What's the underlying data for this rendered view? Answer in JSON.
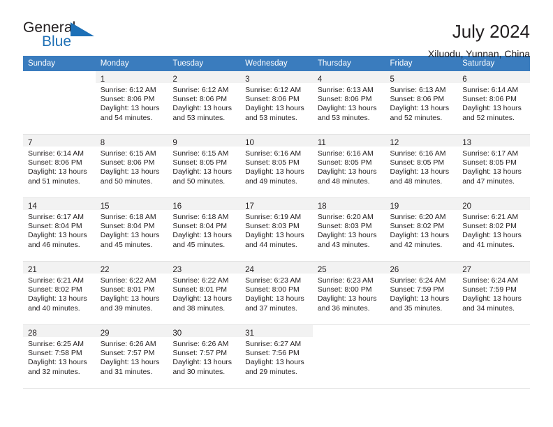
{
  "brand": {
    "name_part1": "General",
    "name_part2": "Blue",
    "triangle_color": "#1d70b7",
    "blue_text_color": "#2071b5"
  },
  "header": {
    "title": "July 2024",
    "subtitle": "Xiluodu, Yunnan, China"
  },
  "theme": {
    "header_row_bg": "#3a7cbe",
    "header_row_text": "#ffffff",
    "daynum_band_bg": "#f2f2f2",
    "grid_line": "#e2e2e2",
    "body_text": "#231f20"
  },
  "weekday_headers": [
    "Sunday",
    "Monday",
    "Tuesday",
    "Wednesday",
    "Thursday",
    "Friday",
    "Saturday"
  ],
  "weeks": [
    [
      {
        "day": "",
        "sunrise": "",
        "sunset": "",
        "daylight_line1": "",
        "daylight_line2": ""
      },
      {
        "day": "1",
        "sunrise": "Sunrise: 6:12 AM",
        "sunset": "Sunset: 8:06 PM",
        "daylight_line1": "Daylight: 13 hours",
        "daylight_line2": "and 54 minutes."
      },
      {
        "day": "2",
        "sunrise": "Sunrise: 6:12 AM",
        "sunset": "Sunset: 8:06 PM",
        "daylight_line1": "Daylight: 13 hours",
        "daylight_line2": "and 53 minutes."
      },
      {
        "day": "3",
        "sunrise": "Sunrise: 6:12 AM",
        "sunset": "Sunset: 8:06 PM",
        "daylight_line1": "Daylight: 13 hours",
        "daylight_line2": "and 53 minutes."
      },
      {
        "day": "4",
        "sunrise": "Sunrise: 6:13 AM",
        "sunset": "Sunset: 8:06 PM",
        "daylight_line1": "Daylight: 13 hours",
        "daylight_line2": "and 53 minutes."
      },
      {
        "day": "5",
        "sunrise": "Sunrise: 6:13 AM",
        "sunset": "Sunset: 8:06 PM",
        "daylight_line1": "Daylight: 13 hours",
        "daylight_line2": "and 52 minutes."
      },
      {
        "day": "6",
        "sunrise": "Sunrise: 6:14 AM",
        "sunset": "Sunset: 8:06 PM",
        "daylight_line1": "Daylight: 13 hours",
        "daylight_line2": "and 52 minutes."
      }
    ],
    [
      {
        "day": "7",
        "sunrise": "Sunrise: 6:14 AM",
        "sunset": "Sunset: 8:06 PM",
        "daylight_line1": "Daylight: 13 hours",
        "daylight_line2": "and 51 minutes."
      },
      {
        "day": "8",
        "sunrise": "Sunrise: 6:15 AM",
        "sunset": "Sunset: 8:06 PM",
        "daylight_line1": "Daylight: 13 hours",
        "daylight_line2": "and 50 minutes."
      },
      {
        "day": "9",
        "sunrise": "Sunrise: 6:15 AM",
        "sunset": "Sunset: 8:05 PM",
        "daylight_line1": "Daylight: 13 hours",
        "daylight_line2": "and 50 minutes."
      },
      {
        "day": "10",
        "sunrise": "Sunrise: 6:16 AM",
        "sunset": "Sunset: 8:05 PM",
        "daylight_line1": "Daylight: 13 hours",
        "daylight_line2": "and 49 minutes."
      },
      {
        "day": "11",
        "sunrise": "Sunrise: 6:16 AM",
        "sunset": "Sunset: 8:05 PM",
        "daylight_line1": "Daylight: 13 hours",
        "daylight_line2": "and 48 minutes."
      },
      {
        "day": "12",
        "sunrise": "Sunrise: 6:16 AM",
        "sunset": "Sunset: 8:05 PM",
        "daylight_line1": "Daylight: 13 hours",
        "daylight_line2": "and 48 minutes."
      },
      {
        "day": "13",
        "sunrise": "Sunrise: 6:17 AM",
        "sunset": "Sunset: 8:05 PM",
        "daylight_line1": "Daylight: 13 hours",
        "daylight_line2": "and 47 minutes."
      }
    ],
    [
      {
        "day": "14",
        "sunrise": "Sunrise: 6:17 AM",
        "sunset": "Sunset: 8:04 PM",
        "daylight_line1": "Daylight: 13 hours",
        "daylight_line2": "and 46 minutes."
      },
      {
        "day": "15",
        "sunrise": "Sunrise: 6:18 AM",
        "sunset": "Sunset: 8:04 PM",
        "daylight_line1": "Daylight: 13 hours",
        "daylight_line2": "and 45 minutes."
      },
      {
        "day": "16",
        "sunrise": "Sunrise: 6:18 AM",
        "sunset": "Sunset: 8:04 PM",
        "daylight_line1": "Daylight: 13 hours",
        "daylight_line2": "and 45 minutes."
      },
      {
        "day": "17",
        "sunrise": "Sunrise: 6:19 AM",
        "sunset": "Sunset: 8:03 PM",
        "daylight_line1": "Daylight: 13 hours",
        "daylight_line2": "and 44 minutes."
      },
      {
        "day": "18",
        "sunrise": "Sunrise: 6:20 AM",
        "sunset": "Sunset: 8:03 PM",
        "daylight_line1": "Daylight: 13 hours",
        "daylight_line2": "and 43 minutes."
      },
      {
        "day": "19",
        "sunrise": "Sunrise: 6:20 AM",
        "sunset": "Sunset: 8:02 PM",
        "daylight_line1": "Daylight: 13 hours",
        "daylight_line2": "and 42 minutes."
      },
      {
        "day": "20",
        "sunrise": "Sunrise: 6:21 AM",
        "sunset": "Sunset: 8:02 PM",
        "daylight_line1": "Daylight: 13 hours",
        "daylight_line2": "and 41 minutes."
      }
    ],
    [
      {
        "day": "21",
        "sunrise": "Sunrise: 6:21 AM",
        "sunset": "Sunset: 8:02 PM",
        "daylight_line1": "Daylight: 13 hours",
        "daylight_line2": "and 40 minutes."
      },
      {
        "day": "22",
        "sunrise": "Sunrise: 6:22 AM",
        "sunset": "Sunset: 8:01 PM",
        "daylight_line1": "Daylight: 13 hours",
        "daylight_line2": "and 39 minutes."
      },
      {
        "day": "23",
        "sunrise": "Sunrise: 6:22 AM",
        "sunset": "Sunset: 8:01 PM",
        "daylight_line1": "Daylight: 13 hours",
        "daylight_line2": "and 38 minutes."
      },
      {
        "day": "24",
        "sunrise": "Sunrise: 6:23 AM",
        "sunset": "Sunset: 8:00 PM",
        "daylight_line1": "Daylight: 13 hours",
        "daylight_line2": "and 37 minutes."
      },
      {
        "day": "25",
        "sunrise": "Sunrise: 6:23 AM",
        "sunset": "Sunset: 8:00 PM",
        "daylight_line1": "Daylight: 13 hours",
        "daylight_line2": "and 36 minutes."
      },
      {
        "day": "26",
        "sunrise": "Sunrise: 6:24 AM",
        "sunset": "Sunset: 7:59 PM",
        "daylight_line1": "Daylight: 13 hours",
        "daylight_line2": "and 35 minutes."
      },
      {
        "day": "27",
        "sunrise": "Sunrise: 6:24 AM",
        "sunset": "Sunset: 7:59 PM",
        "daylight_line1": "Daylight: 13 hours",
        "daylight_line2": "and 34 minutes."
      }
    ],
    [
      {
        "day": "28",
        "sunrise": "Sunrise: 6:25 AM",
        "sunset": "Sunset: 7:58 PM",
        "daylight_line1": "Daylight: 13 hours",
        "daylight_line2": "and 32 minutes."
      },
      {
        "day": "29",
        "sunrise": "Sunrise: 6:26 AM",
        "sunset": "Sunset: 7:57 PM",
        "daylight_line1": "Daylight: 13 hours",
        "daylight_line2": "and 31 minutes."
      },
      {
        "day": "30",
        "sunrise": "Sunrise: 6:26 AM",
        "sunset": "Sunset: 7:57 PM",
        "daylight_line1": "Daylight: 13 hours",
        "daylight_line2": "and 30 minutes."
      },
      {
        "day": "31",
        "sunrise": "Sunrise: 6:27 AM",
        "sunset": "Sunset: 7:56 PM",
        "daylight_line1": "Daylight: 13 hours",
        "daylight_line2": "and 29 minutes."
      },
      {
        "day": "",
        "sunrise": "",
        "sunset": "",
        "daylight_line1": "",
        "daylight_line2": ""
      },
      {
        "day": "",
        "sunrise": "",
        "sunset": "",
        "daylight_line1": "",
        "daylight_line2": ""
      },
      {
        "day": "",
        "sunrise": "",
        "sunset": "",
        "daylight_line1": "",
        "daylight_line2": ""
      }
    ]
  ]
}
